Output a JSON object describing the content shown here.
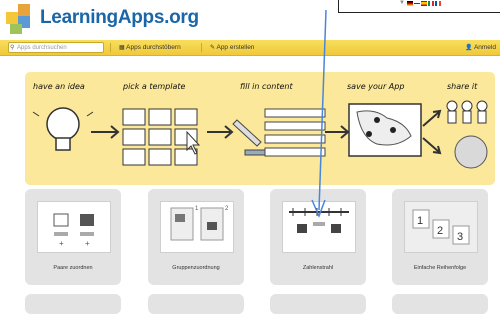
{
  "brand": "LearningApps.org",
  "nav": {
    "search_placeholder": "Apps durchsuchen",
    "browse": "Apps durchstöbern",
    "create": "App erstellen",
    "login": "Anmeld"
  },
  "banner_steps": [
    "have an idea",
    "pick a template",
    "fill in content",
    "save your App",
    "share it"
  ],
  "templates": [
    {
      "label": "Paare zuordnen"
    },
    {
      "label": "Gruppenzuordnung"
    },
    {
      "label": "Zahlenstrahl"
    },
    {
      "label": "Einfache Reihenfolge"
    }
  ],
  "icons": {
    "search": "search-icon",
    "grid": "grid-icon",
    "pencil": "pencil-icon",
    "user": "user-icon"
  },
  "colors": {
    "brand_blue": "#1a66a8",
    "nav_yellow": "#f0c93a",
    "banner_yellow": "#fbe89a",
    "tile_grey": "#e3e3e3",
    "pointer_blue": "#4a86d8"
  }
}
